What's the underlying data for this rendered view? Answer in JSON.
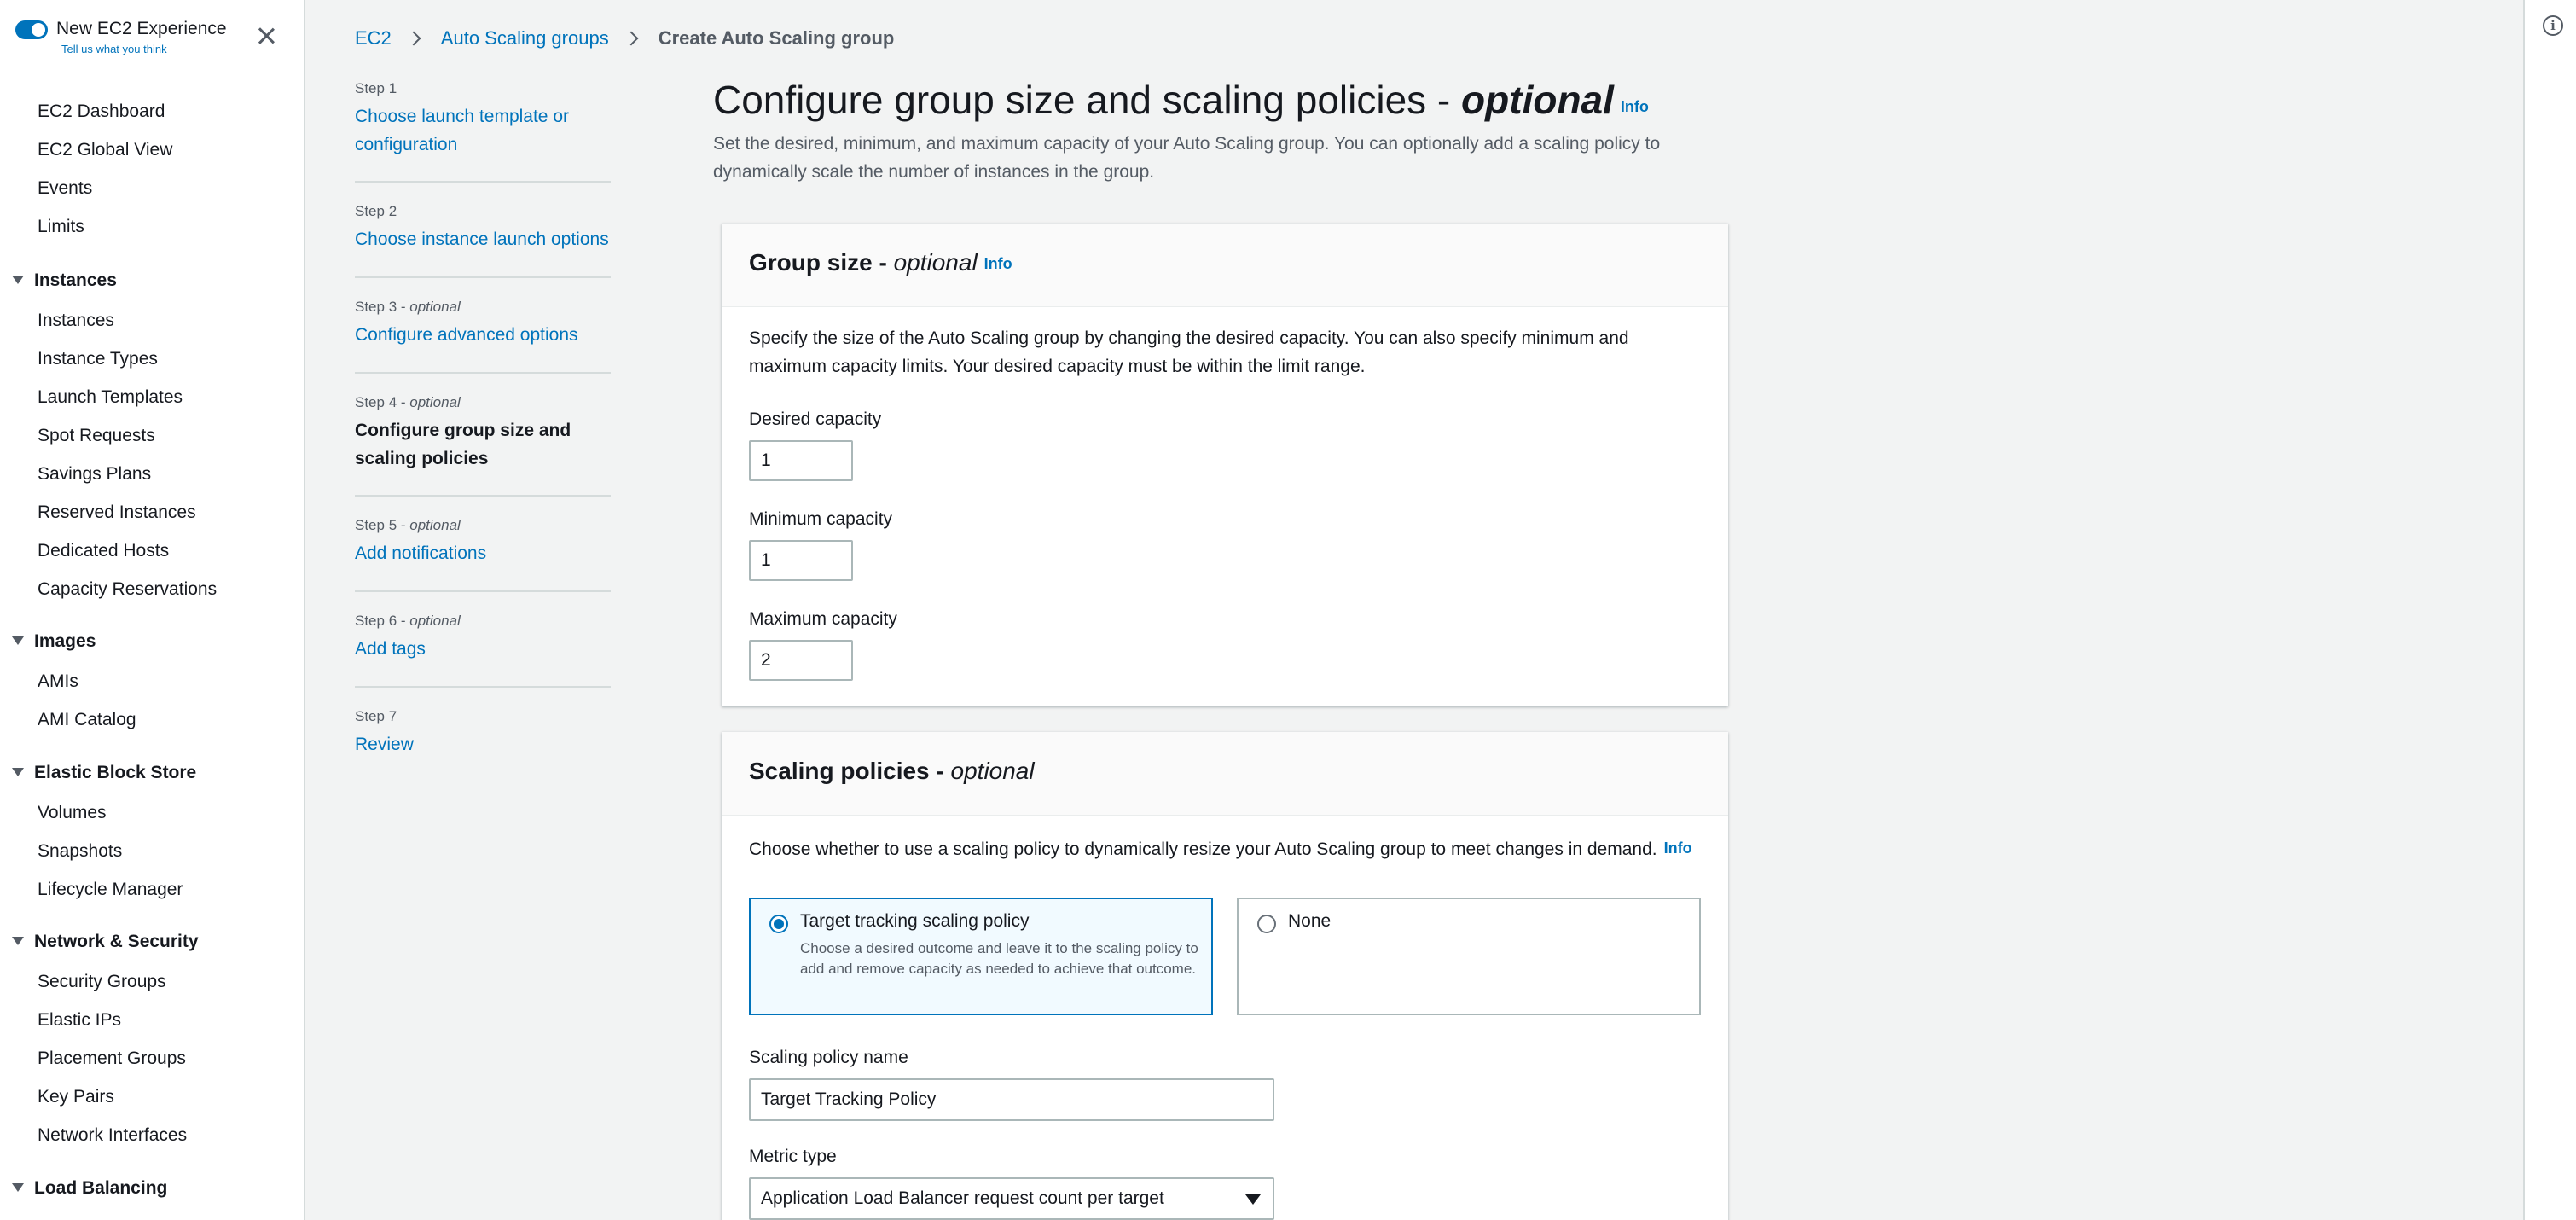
{
  "nav": {
    "toggle_label": "New EC2 Experience",
    "feedback_link": "Tell us what you think",
    "top_items": [
      "EC2 Dashboard",
      "EC2 Global View",
      "Events",
      "Limits"
    ],
    "sections": [
      {
        "title": "Instances",
        "items": [
          "Instances",
          "Instance Types",
          "Launch Templates",
          "Spot Requests",
          "Savings Plans",
          "Reserved Instances",
          "Dedicated Hosts",
          "Capacity Reservations"
        ]
      },
      {
        "title": "Images",
        "items": [
          "AMIs",
          "AMI Catalog"
        ]
      },
      {
        "title": "Elastic Block Store",
        "items": [
          "Volumes",
          "Snapshots",
          "Lifecycle Manager"
        ]
      },
      {
        "title": "Network & Security",
        "items": [
          "Security Groups",
          "Elastic IPs",
          "Placement Groups",
          "Key Pairs",
          "Network Interfaces"
        ]
      },
      {
        "title": "Load Balancing",
        "items": []
      }
    ]
  },
  "breadcrumb": {
    "items": [
      "EC2",
      "Auto Scaling groups"
    ],
    "current": "Create Auto Scaling group"
  },
  "steps": [
    {
      "label": "Step 1",
      "optional": "",
      "title": "Choose launch template or configuration"
    },
    {
      "label": "Step 2",
      "optional": "",
      "title": "Choose instance launch options"
    },
    {
      "label": "Step 3 - ",
      "optional": "optional",
      "title": "Configure advanced options"
    },
    {
      "label": "Step 4 - ",
      "optional": "optional",
      "title": "Configure group size and scaling policies"
    },
    {
      "label": "Step 5 - ",
      "optional": "optional",
      "title": "Add notifications"
    },
    {
      "label": "Step 6 - ",
      "optional": "optional",
      "title": "Add tags"
    },
    {
      "label": "Step 7",
      "optional": "",
      "title": "Review"
    }
  ],
  "main": {
    "title": "Configure group size and scaling policies - ",
    "title_optional": "optional",
    "info": "Info",
    "description": "Set the desired, minimum, and maximum capacity of your Auto Scaling group. You can optionally add a scaling policy to dynamically scale the number of instances in the group."
  },
  "group_size": {
    "heading": "Group size - ",
    "heading_optional": "optional",
    "info": "Info",
    "description": "Specify the size of the Auto Scaling group by changing the desired capacity. You can also specify minimum and maximum capacity limits. Your desired capacity must be within the limit range.",
    "desired_label": "Desired capacity",
    "desired_value": "1",
    "min_label": "Minimum capacity",
    "min_value": "1",
    "max_label": "Maximum capacity",
    "max_value": "2"
  },
  "scaling": {
    "heading": "Scaling policies - ",
    "heading_optional": "optional",
    "description": "Choose whether to use a scaling policy to dynamically resize your Auto Scaling group to meet changes in demand.",
    "info": "Info",
    "option_tracking_title": "Target tracking scaling policy",
    "option_tracking_desc": "Choose a desired outcome and leave it to the scaling policy to add and remove capacity as needed to achieve that outcome.",
    "option_none_title": "None",
    "selected": "target-tracking",
    "policy_name_label": "Scaling policy name",
    "policy_name_value": "Target Tracking Policy",
    "metric_label": "Metric type",
    "metric_value": "Application Load Balancer request count per target"
  },
  "colors": {
    "accent": "#0073bb",
    "background": "#f2f3f3",
    "text": "#16191f",
    "secondary_text": "#545b64"
  },
  "icons": [
    "toggle-switch",
    "close-icon",
    "chevron-right-icon",
    "caret-down-icon",
    "info-circle-icon",
    "radio-button"
  ]
}
